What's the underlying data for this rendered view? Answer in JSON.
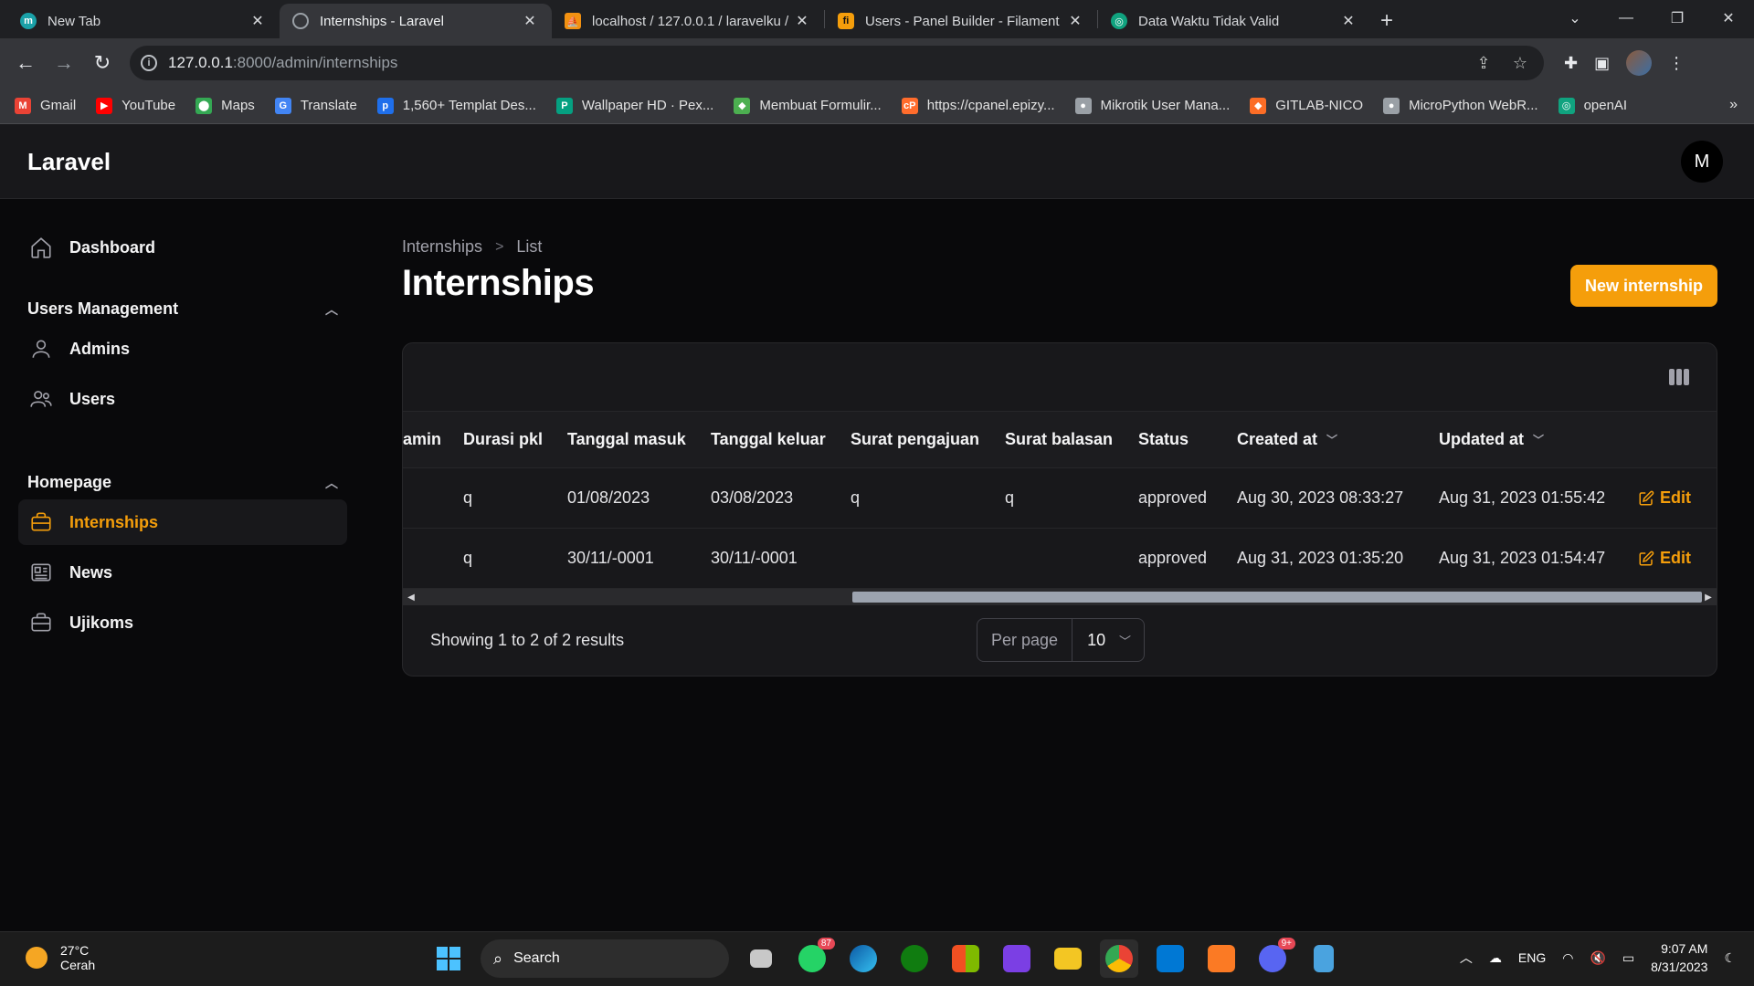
{
  "browser": {
    "tabs": [
      {
        "title": "New Tab",
        "icon": "m",
        "icon_color": "#1aa1a8",
        "active": false
      },
      {
        "title": "Internships - Laravel",
        "icon": "globe",
        "icon_color": "#5f6368",
        "active": true
      },
      {
        "title": "localhost / 127.0.0.1 / laravelku /",
        "icon": "phpmyadmin",
        "icon_color": "#f29111",
        "active": false
      },
      {
        "title": "Users - Panel Builder - Filament",
        "icon": "fi",
        "icon_color": "#f59e0b",
        "active": false
      },
      {
        "title": "Data Waktu Tidak Valid",
        "icon": "openai",
        "icon_color": "#10a37f",
        "active": false
      }
    ],
    "url_host": "127.0.0.1",
    "url_path": ":8000/admin/internships",
    "bookmarks": [
      {
        "label": "Gmail",
        "color": "#ea4335",
        "glyph": "M"
      },
      {
        "label": "YouTube",
        "color": "#ff0000",
        "glyph": "▶"
      },
      {
        "label": "Maps",
        "color": "#34a853",
        "glyph": "⬤"
      },
      {
        "label": "Translate",
        "color": "#4285f4",
        "glyph": "G"
      },
      {
        "label": "1,560+ Templat Des...",
        "color": "#1f6feb",
        "glyph": "p"
      },
      {
        "label": "Wallpaper HD · Pex...",
        "color": "#05a081",
        "glyph": "P"
      },
      {
        "label": "Membuat Formulir...",
        "color": "#4caf50",
        "glyph": "◆"
      },
      {
        "label": "https://cpanel.epizy...",
        "color": "#ff6c2c",
        "glyph": "cP"
      },
      {
        "label": "Mikrotik User Mana...",
        "color": "#9aa0a6",
        "glyph": "●"
      },
      {
        "label": "GITLAB-NICO",
        "color": "#fc6d26",
        "glyph": "◆"
      },
      {
        "label": "MicroPython WebR...",
        "color": "#9aa0a6",
        "glyph": "●"
      },
      {
        "label": "openAI",
        "color": "#10a37f",
        "glyph": "◎"
      }
    ]
  },
  "app": {
    "brand": "Laravel",
    "avatar_initial": "M",
    "accent": "#f59e0b",
    "sidebar": {
      "dashboard": "Dashboard",
      "groups": [
        {
          "label": "Users Management",
          "items": [
            "Admins",
            "Users"
          ]
        },
        {
          "label": "Homepage",
          "items": [
            "Internships",
            "News",
            "Ujikoms"
          ]
        }
      ],
      "active_item": "Internships"
    },
    "breadcrumb": [
      "Internships",
      "List"
    ],
    "page_title": "Internships",
    "new_button": "New internship",
    "table": {
      "columns": [
        "amin",
        "Durasi pkl",
        "Tanggal masuk",
        "Tanggal keluar",
        "Surat pengajuan",
        "Surat balasan",
        "Status",
        "Created at",
        "Updated at"
      ],
      "rows": [
        {
          "durasi": "q",
          "masuk": "01/08/2023",
          "keluar": "03/08/2023",
          "pengajuan": "q",
          "balasan": "q",
          "status": "approved",
          "created": "Aug 30, 2023 08:33:27",
          "updated": "Aug 31, 2023 01:55:42",
          "action": "Edit"
        },
        {
          "durasi": "q",
          "masuk": "30/11/-0001",
          "keluar": "30/11/-0001",
          "pengajuan": "",
          "balasan": "",
          "status": "approved",
          "created": "Aug 31, 2023 01:35:20",
          "updated": "Aug 31, 2023 01:54:47",
          "action": "Edit"
        }
      ],
      "scroll_position": 0.34
    },
    "pagination": {
      "summary": "Showing 1 to 2 of 2 results",
      "per_page_label": "Per page",
      "per_page_value": "10"
    }
  },
  "taskbar": {
    "temperature": "27°C",
    "weather": "Cerah",
    "search": "Search",
    "whatsapp_badge": "87",
    "discord_badge": "9+",
    "lang": "ENG",
    "time": "9:07 AM",
    "date": "8/31/2023"
  }
}
